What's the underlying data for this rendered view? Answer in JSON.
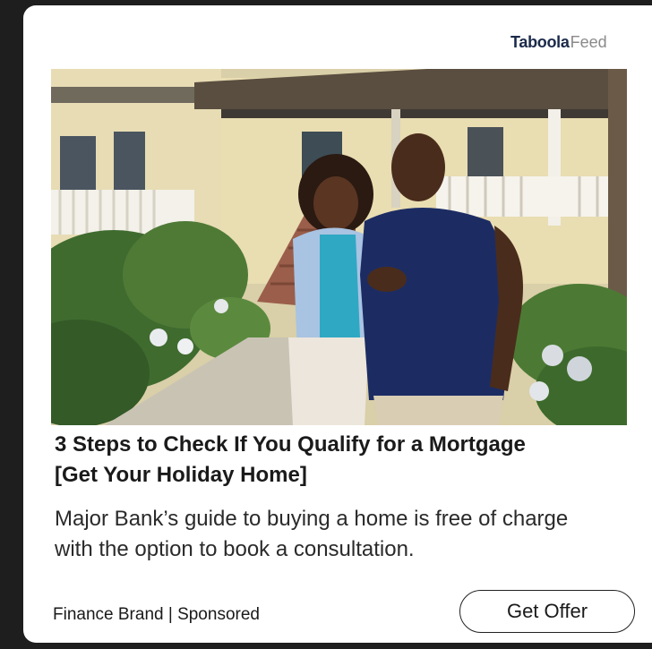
{
  "brand": {
    "logo": "Taboola",
    "suffix": "Feed"
  },
  "ad": {
    "headline": "3 Steps to Check If You Qualify for a Mortgage [Get Your Holiday Home]",
    "description": "Major Bank’s guide to buying a home is free of charge with the option to book a consultation.",
    "advertiser": "Finance Brand | Sponsored",
    "cta_label": "Get Offer"
  }
}
